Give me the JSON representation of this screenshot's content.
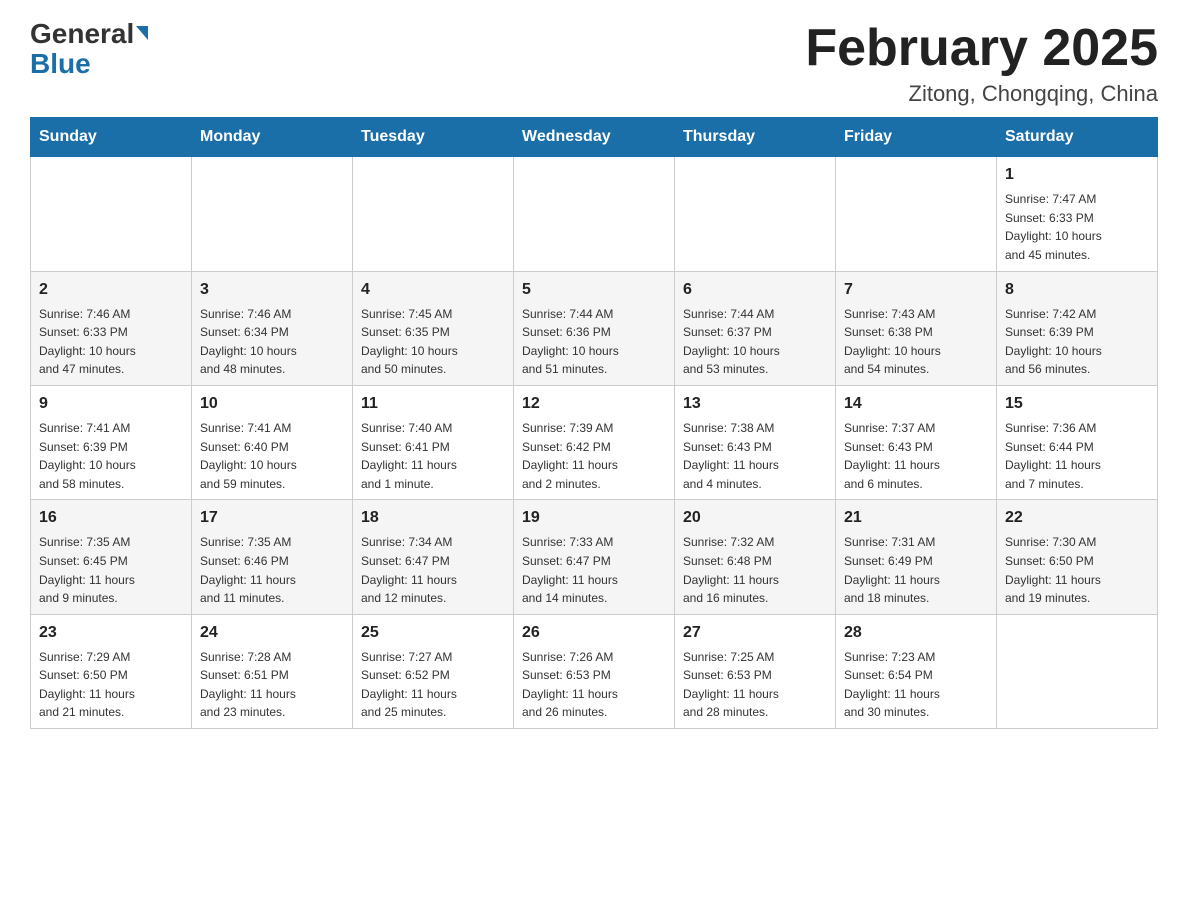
{
  "header": {
    "logo": {
      "general": "General",
      "blue": "Blue"
    },
    "title": "February 2025",
    "subtitle": "Zitong, Chongqing, China"
  },
  "days_of_week": [
    "Sunday",
    "Monday",
    "Tuesday",
    "Wednesday",
    "Thursday",
    "Friday",
    "Saturday"
  ],
  "weeks": [
    [
      {
        "day": "",
        "info": ""
      },
      {
        "day": "",
        "info": ""
      },
      {
        "day": "",
        "info": ""
      },
      {
        "day": "",
        "info": ""
      },
      {
        "day": "",
        "info": ""
      },
      {
        "day": "",
        "info": ""
      },
      {
        "day": "1",
        "info": "Sunrise: 7:47 AM\nSunset: 6:33 PM\nDaylight: 10 hours\nand 45 minutes."
      }
    ],
    [
      {
        "day": "2",
        "info": "Sunrise: 7:46 AM\nSunset: 6:33 PM\nDaylight: 10 hours\nand 47 minutes."
      },
      {
        "day": "3",
        "info": "Sunrise: 7:46 AM\nSunset: 6:34 PM\nDaylight: 10 hours\nand 48 minutes."
      },
      {
        "day": "4",
        "info": "Sunrise: 7:45 AM\nSunset: 6:35 PM\nDaylight: 10 hours\nand 50 minutes."
      },
      {
        "day": "5",
        "info": "Sunrise: 7:44 AM\nSunset: 6:36 PM\nDaylight: 10 hours\nand 51 minutes."
      },
      {
        "day": "6",
        "info": "Sunrise: 7:44 AM\nSunset: 6:37 PM\nDaylight: 10 hours\nand 53 minutes."
      },
      {
        "day": "7",
        "info": "Sunrise: 7:43 AM\nSunset: 6:38 PM\nDaylight: 10 hours\nand 54 minutes."
      },
      {
        "day": "8",
        "info": "Sunrise: 7:42 AM\nSunset: 6:39 PM\nDaylight: 10 hours\nand 56 minutes."
      }
    ],
    [
      {
        "day": "9",
        "info": "Sunrise: 7:41 AM\nSunset: 6:39 PM\nDaylight: 10 hours\nand 58 minutes."
      },
      {
        "day": "10",
        "info": "Sunrise: 7:41 AM\nSunset: 6:40 PM\nDaylight: 10 hours\nand 59 minutes."
      },
      {
        "day": "11",
        "info": "Sunrise: 7:40 AM\nSunset: 6:41 PM\nDaylight: 11 hours\nand 1 minute."
      },
      {
        "day": "12",
        "info": "Sunrise: 7:39 AM\nSunset: 6:42 PM\nDaylight: 11 hours\nand 2 minutes."
      },
      {
        "day": "13",
        "info": "Sunrise: 7:38 AM\nSunset: 6:43 PM\nDaylight: 11 hours\nand 4 minutes."
      },
      {
        "day": "14",
        "info": "Sunrise: 7:37 AM\nSunset: 6:43 PM\nDaylight: 11 hours\nand 6 minutes."
      },
      {
        "day": "15",
        "info": "Sunrise: 7:36 AM\nSunset: 6:44 PM\nDaylight: 11 hours\nand 7 minutes."
      }
    ],
    [
      {
        "day": "16",
        "info": "Sunrise: 7:35 AM\nSunset: 6:45 PM\nDaylight: 11 hours\nand 9 minutes."
      },
      {
        "day": "17",
        "info": "Sunrise: 7:35 AM\nSunset: 6:46 PM\nDaylight: 11 hours\nand 11 minutes."
      },
      {
        "day": "18",
        "info": "Sunrise: 7:34 AM\nSunset: 6:47 PM\nDaylight: 11 hours\nand 12 minutes."
      },
      {
        "day": "19",
        "info": "Sunrise: 7:33 AM\nSunset: 6:47 PM\nDaylight: 11 hours\nand 14 minutes."
      },
      {
        "day": "20",
        "info": "Sunrise: 7:32 AM\nSunset: 6:48 PM\nDaylight: 11 hours\nand 16 minutes."
      },
      {
        "day": "21",
        "info": "Sunrise: 7:31 AM\nSunset: 6:49 PM\nDaylight: 11 hours\nand 18 minutes."
      },
      {
        "day": "22",
        "info": "Sunrise: 7:30 AM\nSunset: 6:50 PM\nDaylight: 11 hours\nand 19 minutes."
      }
    ],
    [
      {
        "day": "23",
        "info": "Sunrise: 7:29 AM\nSunset: 6:50 PM\nDaylight: 11 hours\nand 21 minutes."
      },
      {
        "day": "24",
        "info": "Sunrise: 7:28 AM\nSunset: 6:51 PM\nDaylight: 11 hours\nand 23 minutes."
      },
      {
        "day": "25",
        "info": "Sunrise: 7:27 AM\nSunset: 6:52 PM\nDaylight: 11 hours\nand 25 minutes."
      },
      {
        "day": "26",
        "info": "Sunrise: 7:26 AM\nSunset: 6:53 PM\nDaylight: 11 hours\nand 26 minutes."
      },
      {
        "day": "27",
        "info": "Sunrise: 7:25 AM\nSunset: 6:53 PM\nDaylight: 11 hours\nand 28 minutes."
      },
      {
        "day": "28",
        "info": "Sunrise: 7:23 AM\nSunset: 6:54 PM\nDaylight: 11 hours\nand 30 minutes."
      },
      {
        "day": "",
        "info": ""
      }
    ]
  ]
}
